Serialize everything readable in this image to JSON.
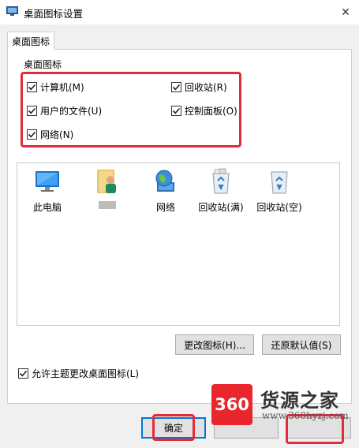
{
  "window": {
    "title": "桌面图标设置",
    "close_glyph": "✕"
  },
  "tab": {
    "label": "桌面图标"
  },
  "group": {
    "legend": "桌面图标",
    "checkboxes": [
      {
        "label": "计算机(M)",
        "checked": true
      },
      {
        "label": "回收站(R)",
        "checked": true
      },
      {
        "label": "用户的文件(U)",
        "checked": true
      },
      {
        "label": "控制面板(O)",
        "checked": true
      },
      {
        "label": "网络(N)",
        "checked": true
      }
    ]
  },
  "icons": [
    {
      "label": "此电脑",
      "icon": "monitor-icon"
    },
    {
      "label": "",
      "icon": "user-folder-icon"
    },
    {
      "label": "网络",
      "icon": "network-globe-icon"
    },
    {
      "label": "回收站(满)",
      "icon": "recycle-bin-full-icon"
    },
    {
      "label": "回收站(空)",
      "icon": "recycle-bin-empty-icon"
    }
  ],
  "buttons": {
    "change_icon": "更改图标(H)...",
    "restore_default": "还原默认值(S)",
    "ok": "确定"
  },
  "allow_theme": {
    "label": "允许主题更改桌面图标(L)",
    "checked": true
  },
  "watermark": {
    "logo": "360",
    "name": "货源之家",
    "url": "www.360hyzj.com"
  },
  "colors": {
    "highlight_red": "#e32b3b",
    "focus_blue": "#0078d7"
  }
}
